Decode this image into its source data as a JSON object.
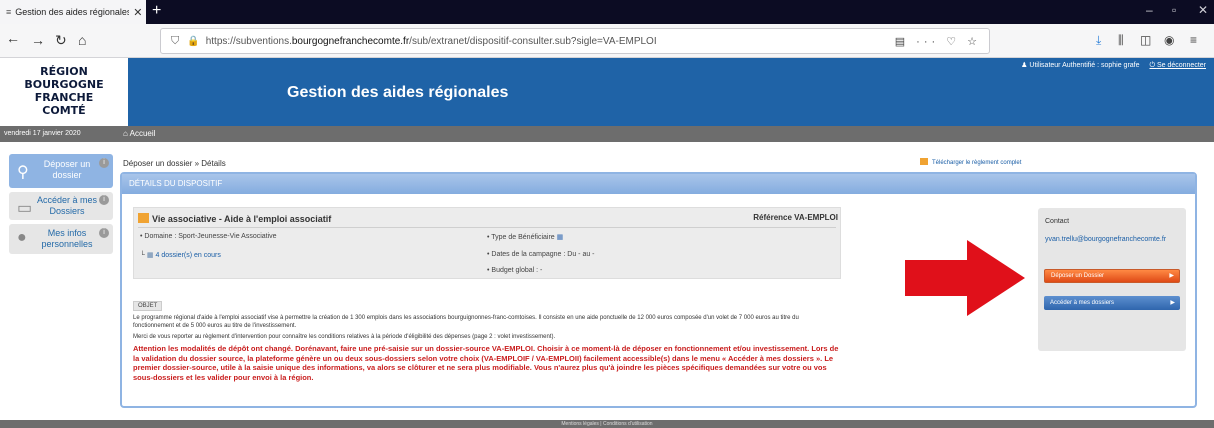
{
  "browser": {
    "tab_title": "Gestion des aides régionales de ",
    "url_prefix": "https://subventions.",
    "url_domain": "bourgognefranchecomte.fr",
    "url_path": "/sub/extranet/dispositif-consulter.sub?sigle=VA-EMPLOI",
    "icons": [
      "reader-icon",
      "more-icon",
      "pocket-icon",
      "star-icon",
      "download-icon",
      "library-icon",
      "sidebar-icon",
      "account-icon",
      "menu-icon"
    ]
  },
  "header": {
    "logo_lines": [
      "RÉGION",
      "BOURGOGNE",
      "FRANCHE",
      "COMTÉ"
    ],
    "title": "Gestion des aides régionales",
    "user": "Utilisateur Authentifié : sophie grafe",
    "logout": "Se déconnecter"
  },
  "datebar": {
    "date": "vendredi 17 janvier 2020",
    "home": "Accueil"
  },
  "sidebar": {
    "items": [
      {
        "label": "Déposer un dossier"
      },
      {
        "label": "Accéder à mes Dossiers"
      },
      {
        "label": "Mes infos personnelles"
      }
    ]
  },
  "breadcrumb": "Déposer un dossier » Détails",
  "panel": {
    "heading": "DÉTAILS DU DISPOSITIF",
    "dispositif_title": "Vie associative - Aide à l'emploi associatif",
    "reference": "Référence VA-EMPLOI",
    "domaine": "• Domaine : Sport-Jeunesse-Vie Associative",
    "dossiers_link": "4 dossier(s) en cours",
    "type_beneficiaire": "• Type de Bénéficiaire",
    "dates_campagne": "• Dates de la campagne : Du - au -",
    "budget": "• Budget global : -",
    "objet_label": "OBJET",
    "objet_text_1": "Le programme régional d'aide à l'emploi associatif vise à permettre la création de 1 300 emplois dans les associations bourguignonnes-franc-comtoises. Il consiste en une aide ponctuelle de 12 000 euros composée d'un volet de 7 000 euros au titre du fonctionnement et de 5 000 euros au titre de l'investissement.",
    "objet_text_2": "Merci de vous reporter au règlement d'intervention pour connaître les conditions relatives à la période d'éligibilité des dépenses (page 2 : volet investissement).",
    "warning": "Attention les modalités de dépôt ont changé. Dorénavant, faire une pré-saisie sur un dossier-source VA-EMPLOI. Choisir à ce moment-là de déposer en fonctionnement et/ou investissement. Lors de la validation du dossier source, la plateforme génère un ou deux sous-dossiers selon votre choix (VA-EMPLOIF / VA-EMPLOII) facilement accessible(s) dans le menu « Accéder à mes dossiers ». Le premier dossier-source, utile à la saisie unique des informations, va alors se clôturer et ne sera plus modifiable. Vous n'aurez plus qu'à joindre les pièces spécifiques demandées sur votre ou vos sous-dossiers et les valider pour envoi à la région."
  },
  "right": {
    "contact_label": "Contact",
    "contact_email": "yvan.trellu@bourgognefranchecomte.fr",
    "btn_deposer": "Déposer un Dossier",
    "btn_acceder": "Accéder à mes dossiers",
    "download": "Télécharger le règlement complet"
  },
  "footer": "Mentions légales  |  Conditions d'utilisation",
  "colors": {
    "header_blue": "#1f63a7",
    "arrow_red": "#e0101a",
    "orange_button": "#e5541f"
  }
}
